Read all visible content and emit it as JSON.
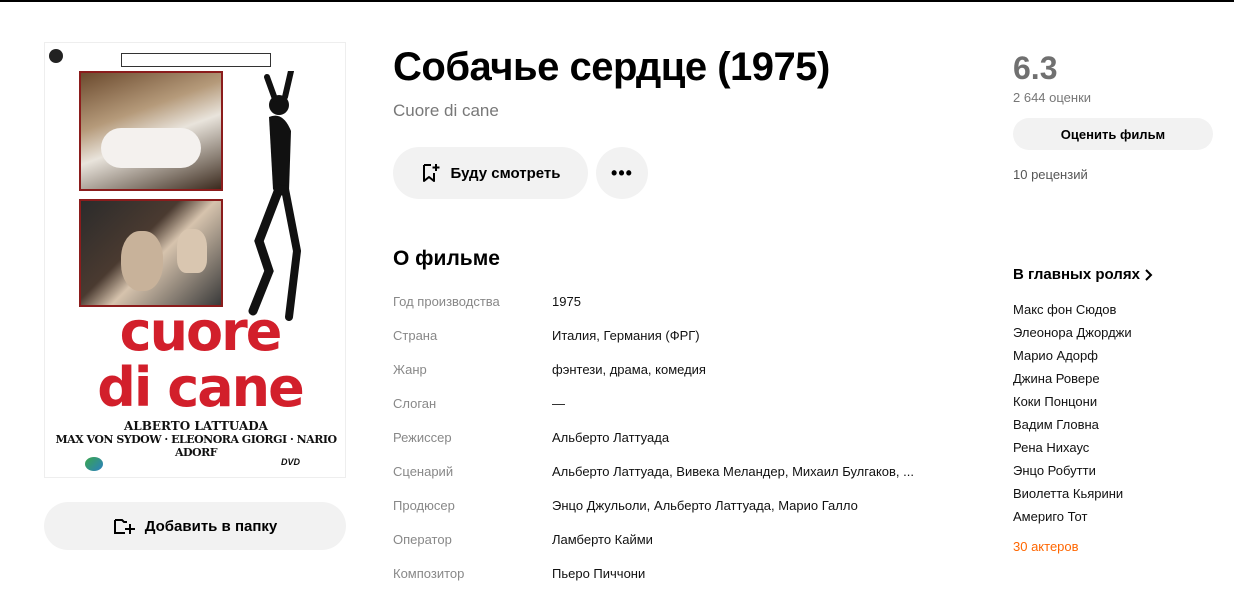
{
  "movie": {
    "title": "Собачье сердце (1975)",
    "original_title": "Cuore di cane"
  },
  "poster": {
    "title_line1": "cuore",
    "title_line2": "di cane",
    "director": "ALBERTO LATTUADA",
    "cast": "MAX VON SYDOW · ELEONORA GIORGI · NARIO ADORF",
    "format": "DVD"
  },
  "actions": {
    "add_folder_label": "Добавить в папку",
    "watch_label": "Буду смотреть",
    "more_label": "•••"
  },
  "about": {
    "heading": "О фильме",
    "rows": [
      {
        "key": "Год производства",
        "value": "1975"
      },
      {
        "key": "Страна",
        "value": "Италия, Германия (ФРГ)"
      },
      {
        "key": "Жанр",
        "value": "фэнтези, драма, комедия"
      },
      {
        "key": "Слоган",
        "value": "—"
      },
      {
        "key": "Режиссер",
        "value": "Альберто Латтуада"
      },
      {
        "key": "Сценарий",
        "value": "Альберто Латтуада, Вивека Меландер, Михаил Булгаков, ..."
      },
      {
        "key": "Продюсер",
        "value": "Энцо Джульоли, Альберто Латтуада, Марио Галло"
      },
      {
        "key": "Оператор",
        "value": "Ламберто Кайми"
      },
      {
        "key": "Композитор",
        "value": "Пьеро Пиччони"
      }
    ]
  },
  "rating": {
    "value": "6.3",
    "votes": "2 644 оценки",
    "rate_label": "Оценить фильм",
    "reviews": "10 рецензий"
  },
  "cast": {
    "heading": "В главных ролях",
    "items": [
      "Макс фон Сюдов",
      "Элеонора Джорджи",
      "Марио Адорф",
      "Джина Ровере",
      "Коки Понцони",
      "Вадим Гловна",
      "Рена Нихаус",
      "Энцо Робутти",
      "Виолетта Кьярини",
      "Америго Тот"
    ],
    "more_label": "30 актеров"
  },
  "colors": {
    "accent": "#ff6600",
    "button_bg": "#f2f2f2",
    "rating_gray": "#707070",
    "poster_red": "#d21f2b"
  }
}
